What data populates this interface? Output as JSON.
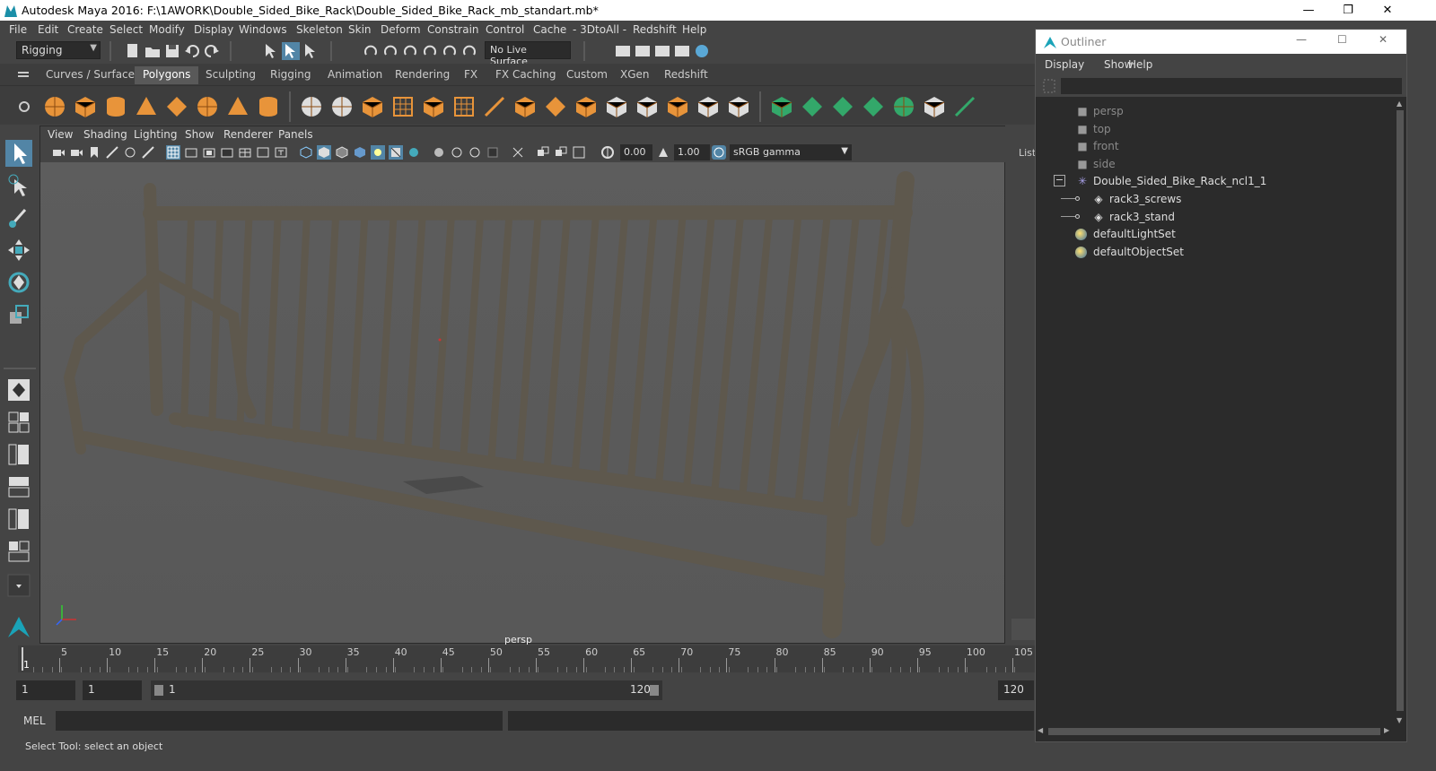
{
  "window": {
    "title": "Autodesk Maya 2016: F:\\1AWORK\\Double_Sided_Bike_Rack\\Double_Sided_Bike_Rack_mb_standart.mb*"
  },
  "menubar": [
    "File",
    "Edit",
    "Create",
    "Select",
    "Modify",
    "Display",
    "Windows",
    "Skeleton",
    "Skin",
    "Deform",
    "Constrain",
    "Control",
    "Cache",
    "- 3DtoAll -",
    "Redshift",
    "Help"
  ],
  "statusline": {
    "mode": "Rigging",
    "live_surface": "No Live Surface"
  },
  "shelf": {
    "tabs": [
      "Curves / Surfaces",
      "Polygons",
      "Sculpting",
      "Rigging",
      "Animation",
      "Rendering",
      "FX",
      "FX Caching",
      "Custom",
      "XGen",
      "Redshift"
    ],
    "active": "Polygons"
  },
  "viewport": {
    "menu": [
      "View",
      "Shading",
      "Lighting",
      "Show",
      "Renderer",
      "Panels"
    ],
    "exposure": "0.00",
    "gamma": "1.00",
    "color_space": "sRGB gamma",
    "camera": "persp",
    "right_label": "List"
  },
  "timeline": {
    "ticks": [
      "5",
      "10",
      "15",
      "20",
      "25",
      "30",
      "35",
      "40",
      "45",
      "50",
      "55",
      "60",
      "65",
      "70",
      "75",
      "80",
      "85",
      "90",
      "95",
      "100",
      "105"
    ],
    "current": "1"
  },
  "range": {
    "start": "1",
    "anim_start": "1",
    "slider_start": "1",
    "slider_end": "120",
    "end": "120"
  },
  "mel": {
    "label": "MEL"
  },
  "help": {
    "text": "Select Tool: select an object"
  },
  "outliner": {
    "title": "Outliner",
    "menu": [
      "Display",
      "Show",
      "Help"
    ],
    "items": [
      {
        "label": "persp",
        "type": "camera",
        "dim": true
      },
      {
        "label": "top",
        "type": "camera",
        "dim": true
      },
      {
        "label": "front",
        "type": "camera",
        "dim": true
      },
      {
        "label": "side",
        "type": "camera",
        "dim": true
      },
      {
        "label": "Double_Sided_Bike_Rack_ncl1_1",
        "type": "group",
        "dim": false
      },
      {
        "label": "rack3_screws",
        "type": "mesh",
        "dim": false
      },
      {
        "label": "rack3_stand",
        "type": "mesh",
        "dim": false
      },
      {
        "label": "defaultLightSet",
        "type": "set",
        "dim": false
      },
      {
        "label": "defaultObjectSet",
        "type": "set",
        "dim": false
      }
    ]
  },
  "colors": {
    "accent": "#5285a6",
    "rust": "#6b6254",
    "background": "#444444"
  }
}
